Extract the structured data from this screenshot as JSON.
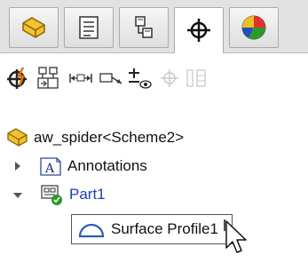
{
  "tabs": [
    {
      "icon": "part-icon",
      "active": false
    },
    {
      "icon": "property-manager-icon",
      "active": false
    },
    {
      "icon": "configuration-manager-icon",
      "active": false
    },
    {
      "icon": "dimxpert-manager-icon",
      "active": true
    },
    {
      "icon": "display-manager-icon",
      "active": false
    }
  ],
  "toolbar": {
    "icons": [
      "auto-dimension-scheme-icon",
      "datum-icon",
      "size-dimension-icon",
      "location-dimension-icon",
      "geometric-tolerance-icon",
      "datum-target-icon",
      "pattern-feature-icon"
    ]
  },
  "tree": {
    "root_label": "aw_spider<Scheme2>",
    "annotations_label": "Annotations",
    "part_label": "Part1",
    "selected_item_label": "Surface Profile1"
  },
  "colors": {
    "accent_blue": "#1a3fb0",
    "part_yellow": "#e8a800",
    "green": "#2a9a2a",
    "red": "#d42020"
  }
}
